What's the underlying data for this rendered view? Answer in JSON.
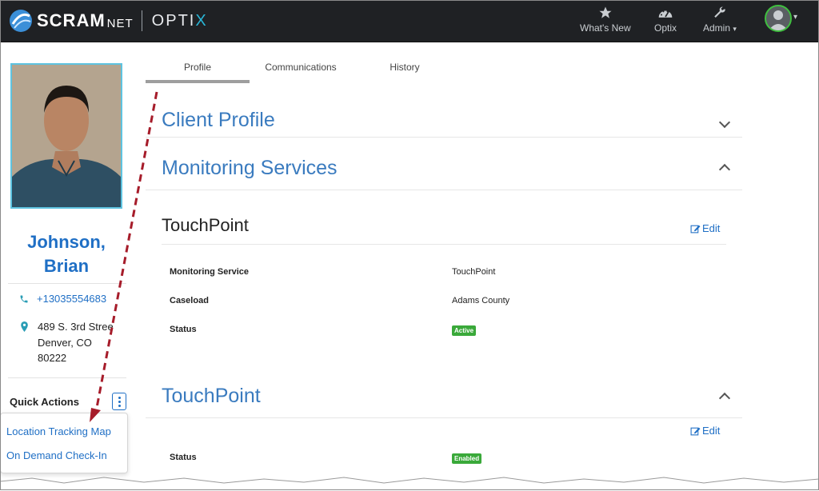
{
  "topbar": {
    "brand_scram": "SCRAM",
    "brand_net": "NET",
    "brand_optix_main": "OPTI",
    "brand_optix_x": "X",
    "nav": [
      {
        "label": "What's New",
        "icon": "star-icon"
      },
      {
        "label": "Optix",
        "icon": "dashboard-gauge-icon"
      },
      {
        "label": "Admin",
        "icon": "wrench-icon"
      }
    ],
    "admin_caret": "▾",
    "avatar_caret": "▾"
  },
  "client": {
    "name_line1": "Johnson,",
    "name_line2": "Brian",
    "phone": "+13035554683",
    "address_line1": "489 S. 3rd Stree",
    "address_line2": "Denver, CO",
    "address_line3": "80222"
  },
  "quick_actions": {
    "title": "Quick Actions",
    "menu": [
      "Location Tracking Map",
      "On Demand Check-In"
    ]
  },
  "tabs": [
    "Profile",
    "Communications",
    "History"
  ],
  "active_tab": "Profile",
  "sections": {
    "client_profile": "Client Profile",
    "monitoring_services": "Monitoring Services"
  },
  "touchpoint_card": {
    "title": "TouchPoint",
    "edit_label": "Edit",
    "fields": [
      {
        "label": "Monitoring Service",
        "value": "TouchPoint"
      },
      {
        "label": "Caseload",
        "value": "Adams County"
      },
      {
        "label": "Status",
        "value": "Active"
      }
    ]
  },
  "touchpoint_section": {
    "title": "TouchPoint",
    "edit_label": "Edit",
    "status_label": "Status",
    "status_value": "Enabled"
  },
  "colors": {
    "accent": "#1f6fc5",
    "section_title": "#3a7bbf",
    "status_green": "#3aa93a",
    "annotation_arrow": "#a61c2a",
    "topbar": "#1f2124"
  }
}
